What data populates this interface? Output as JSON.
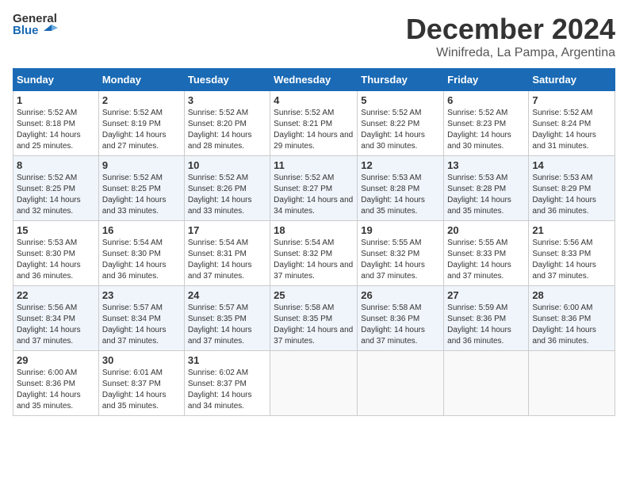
{
  "logo": {
    "line1": "General",
    "line2": "Blue"
  },
  "title": "December 2024",
  "subtitle": "Winifreda, La Pampa, Argentina",
  "days_header": [
    "Sunday",
    "Monday",
    "Tuesday",
    "Wednesday",
    "Thursday",
    "Friday",
    "Saturday"
  ],
  "weeks": [
    [
      {
        "num": "1",
        "sunrise": "5:52 AM",
        "sunset": "8:18 PM",
        "daylight": "14 hours and 25 minutes."
      },
      {
        "num": "2",
        "sunrise": "5:52 AM",
        "sunset": "8:19 PM",
        "daylight": "14 hours and 27 minutes."
      },
      {
        "num": "3",
        "sunrise": "5:52 AM",
        "sunset": "8:20 PM",
        "daylight": "14 hours and 28 minutes."
      },
      {
        "num": "4",
        "sunrise": "5:52 AM",
        "sunset": "8:21 PM",
        "daylight": "14 hours and 29 minutes."
      },
      {
        "num": "5",
        "sunrise": "5:52 AM",
        "sunset": "8:22 PM",
        "daylight": "14 hours and 30 minutes."
      },
      {
        "num": "6",
        "sunrise": "5:52 AM",
        "sunset": "8:23 PM",
        "daylight": "14 hours and 30 minutes."
      },
      {
        "num": "7",
        "sunrise": "5:52 AM",
        "sunset": "8:24 PM",
        "daylight": "14 hours and 31 minutes."
      }
    ],
    [
      {
        "num": "8",
        "sunrise": "5:52 AM",
        "sunset": "8:25 PM",
        "daylight": "14 hours and 32 minutes."
      },
      {
        "num": "9",
        "sunrise": "5:52 AM",
        "sunset": "8:25 PM",
        "daylight": "14 hours and 33 minutes."
      },
      {
        "num": "10",
        "sunrise": "5:52 AM",
        "sunset": "8:26 PM",
        "daylight": "14 hours and 33 minutes."
      },
      {
        "num": "11",
        "sunrise": "5:52 AM",
        "sunset": "8:27 PM",
        "daylight": "14 hours and 34 minutes."
      },
      {
        "num": "12",
        "sunrise": "5:53 AM",
        "sunset": "8:28 PM",
        "daylight": "14 hours and 35 minutes."
      },
      {
        "num": "13",
        "sunrise": "5:53 AM",
        "sunset": "8:28 PM",
        "daylight": "14 hours and 35 minutes."
      },
      {
        "num": "14",
        "sunrise": "5:53 AM",
        "sunset": "8:29 PM",
        "daylight": "14 hours and 36 minutes."
      }
    ],
    [
      {
        "num": "15",
        "sunrise": "5:53 AM",
        "sunset": "8:30 PM",
        "daylight": "14 hours and 36 minutes."
      },
      {
        "num": "16",
        "sunrise": "5:54 AM",
        "sunset": "8:30 PM",
        "daylight": "14 hours and 36 minutes."
      },
      {
        "num": "17",
        "sunrise": "5:54 AM",
        "sunset": "8:31 PM",
        "daylight": "14 hours and 37 minutes."
      },
      {
        "num": "18",
        "sunrise": "5:54 AM",
        "sunset": "8:32 PM",
        "daylight": "14 hours and 37 minutes."
      },
      {
        "num": "19",
        "sunrise": "5:55 AM",
        "sunset": "8:32 PM",
        "daylight": "14 hours and 37 minutes."
      },
      {
        "num": "20",
        "sunrise": "5:55 AM",
        "sunset": "8:33 PM",
        "daylight": "14 hours and 37 minutes."
      },
      {
        "num": "21",
        "sunrise": "5:56 AM",
        "sunset": "8:33 PM",
        "daylight": "14 hours and 37 minutes."
      }
    ],
    [
      {
        "num": "22",
        "sunrise": "5:56 AM",
        "sunset": "8:34 PM",
        "daylight": "14 hours and 37 minutes."
      },
      {
        "num": "23",
        "sunrise": "5:57 AM",
        "sunset": "8:34 PM",
        "daylight": "14 hours and 37 minutes."
      },
      {
        "num": "24",
        "sunrise": "5:57 AM",
        "sunset": "8:35 PM",
        "daylight": "14 hours and 37 minutes."
      },
      {
        "num": "25",
        "sunrise": "5:58 AM",
        "sunset": "8:35 PM",
        "daylight": "14 hours and 37 minutes."
      },
      {
        "num": "26",
        "sunrise": "5:58 AM",
        "sunset": "8:36 PM",
        "daylight": "14 hours and 37 minutes."
      },
      {
        "num": "27",
        "sunrise": "5:59 AM",
        "sunset": "8:36 PM",
        "daylight": "14 hours and 36 minutes."
      },
      {
        "num": "28",
        "sunrise": "6:00 AM",
        "sunset": "8:36 PM",
        "daylight": "14 hours and 36 minutes."
      }
    ],
    [
      {
        "num": "29",
        "sunrise": "6:00 AM",
        "sunset": "8:36 PM",
        "daylight": "14 hours and 35 minutes."
      },
      {
        "num": "30",
        "sunrise": "6:01 AM",
        "sunset": "8:37 PM",
        "daylight": "14 hours and 35 minutes."
      },
      {
        "num": "31",
        "sunrise": "6:02 AM",
        "sunset": "8:37 PM",
        "daylight": "14 hours and 34 minutes."
      },
      null,
      null,
      null,
      null
    ]
  ]
}
